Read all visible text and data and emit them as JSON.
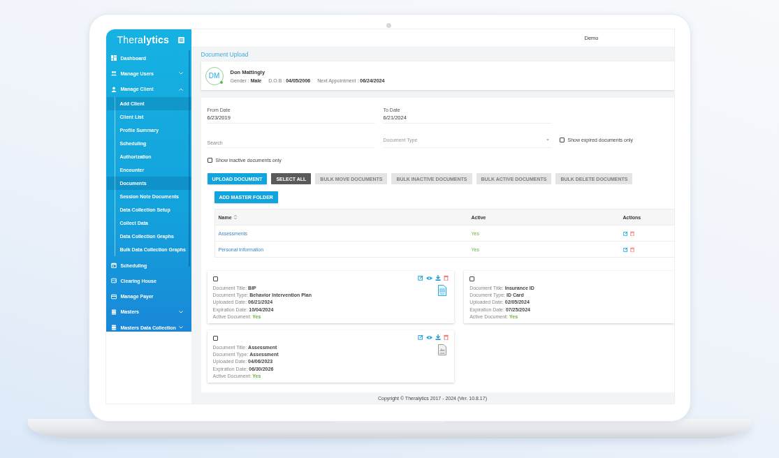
{
  "sidebar": {
    "logo": "Thera**lytics**",
    "items": [
      {
        "label": "Dashboard"
      },
      {
        "label": "Manage Users",
        "expanded": false
      },
      {
        "label": "Manage Client",
        "expanded": true,
        "children": [
          {
            "label": "Add Client",
            "selected": true
          },
          {
            "label": "Client List",
            "selected": false
          },
          {
            "label": "Profile Summary",
            "selected": false
          },
          {
            "label": "Scheduling",
            "selected": false
          },
          {
            "label": "Authorization",
            "selected": false
          },
          {
            "label": "Encounter",
            "selected": false
          },
          {
            "label": "Documents",
            "selected": true
          },
          {
            "label": "Session Note Documents",
            "selected": false
          },
          {
            "label": "Data Collection Setup",
            "selected": false
          },
          {
            "label": "Collect Data",
            "selected": false
          },
          {
            "label": "Data Collection Graphs",
            "selected": false
          },
          {
            "label": "Bulk Data Collection Graphs",
            "selected": false
          }
        ]
      },
      {
        "label": "Scheduling"
      },
      {
        "label": "Clearing House"
      },
      {
        "label": "Manage Payer"
      },
      {
        "label": "Masters",
        "expanded": false
      },
      {
        "label": "Masters Data Collection",
        "expanded": false
      }
    ]
  },
  "topbar": {
    "user": "Demo"
  },
  "page_title": "Document Upload",
  "patient": {
    "initials": "DM",
    "online": true,
    "name": "Don Mattingly",
    "fields": [
      {
        "label": "Gender :",
        "value": "Male"
      },
      {
        "label": "D.O.B :",
        "value": "04/05/2006"
      },
      {
        "label": "Next Appointment :",
        "value": "06/24/2024"
      }
    ]
  },
  "filters": {
    "from_date": {
      "label": "From Date",
      "value": "6/23/2019"
    },
    "to_date": {
      "label": "To Date",
      "value": "6/21/2024"
    },
    "search": {
      "placeholder": "Search"
    },
    "document_type": {
      "placeholder": "Document Type"
    },
    "show_expired": {
      "label": "Show expired documents only",
      "checked": false
    },
    "show_inactive": {
      "label": "Show inactive documents only",
      "checked": false
    }
  },
  "buttons": [
    {
      "label": "UPLOAD DOCUMENT",
      "kind": "primary"
    },
    {
      "label": "SELECT ALL",
      "kind": "dark"
    },
    {
      "label": "BULK MOVE DOCUMENTS",
      "kind": "disabled"
    },
    {
      "label": "BULK INACTIVE DOCUMENTS",
      "kind": "disabled"
    },
    {
      "label": "BULK ACTIVE DOCUMENTS",
      "kind": "disabled"
    },
    {
      "label": "BULK DELETE DOCUMENTS",
      "kind": "disabled"
    }
  ],
  "add_folder_button": "ADD MASTER FOLDER",
  "table": {
    "columns": [
      "Name",
      "Active",
      "Actions"
    ],
    "rows": [
      {
        "name": "Assessments",
        "active": "Yes"
      },
      {
        "name": "Personal Information",
        "active": "Yes"
      }
    ]
  },
  "documents": [
    {
      "checked": false,
      "kind": "document",
      "fields": [
        {
          "label": "Document Title:",
          "value": "BIP"
        },
        {
          "label": "Document Type:",
          "value": "Behavior Intervention Plan"
        },
        {
          "label": "Uploaded Date:",
          "value": "06/21/2024"
        },
        {
          "label": "Expiration Date:",
          "value": "10/04/2024"
        },
        {
          "label": "Active Document:",
          "value": "Yes",
          "kind": "status"
        }
      ]
    },
    {
      "checked": false,
      "kind": "plain",
      "fields": [
        {
          "label": "Document Title:",
          "value": "Insurance ID"
        },
        {
          "label": "Document Type:",
          "value": "ID Card"
        },
        {
          "label": "Uploaded Date:",
          "value": "02/05/2024"
        },
        {
          "label": "Expiration Date:",
          "value": "07/25/2024"
        },
        {
          "label": "Active Document:",
          "value": "Yes",
          "kind": "status"
        }
      ]
    },
    {
      "checked": false,
      "kind": "image",
      "fields": [
        {
          "label": "Document Title:",
          "value": "Assessment"
        },
        {
          "label": "Document Type:",
          "value": "Assessment"
        },
        {
          "label": "Uploaded Date:",
          "value": "04/06/2023"
        },
        {
          "label": "Expiration Date:",
          "value": "06/30/2026"
        },
        {
          "label": "Active Document:",
          "value": "Yes",
          "kind": "status"
        }
      ]
    }
  ],
  "footer": "Copyright © Theralytics 2017 - 2024 (Ver. 10.8.17)"
}
